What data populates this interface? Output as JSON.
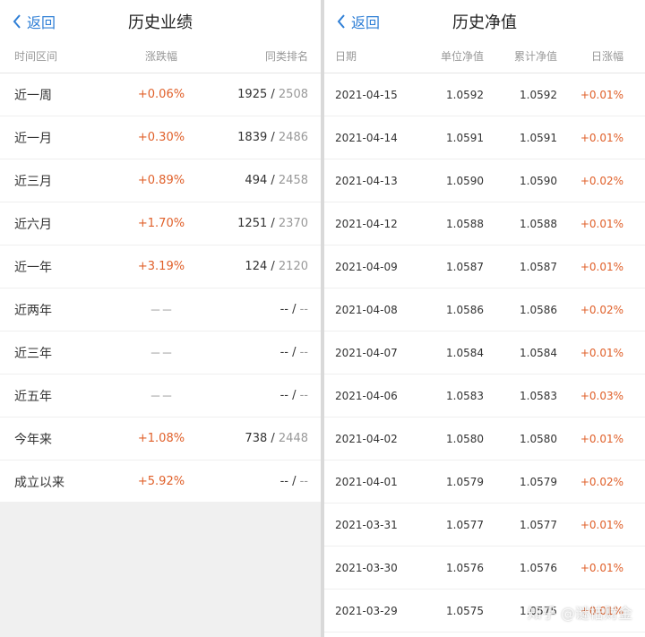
{
  "left": {
    "back_label": "返回",
    "title": "历史业绩",
    "columns": [
      "时间区间",
      "涨跌幅",
      "同类排名"
    ],
    "rows": [
      {
        "period": "近一周",
        "change": "+0.06%",
        "rank": "1925",
        "total": "2508"
      },
      {
        "period": "近一月",
        "change": "+0.30%",
        "rank": "1839",
        "total": "2486"
      },
      {
        "period": "近三月",
        "change": "+0.89%",
        "rank": "494",
        "total": "2458"
      },
      {
        "period": "近六月",
        "change": "+1.70%",
        "rank": "1251",
        "total": "2370"
      },
      {
        "period": "近一年",
        "change": "+3.19%",
        "rank": "124",
        "total": "2120"
      },
      {
        "period": "近两年",
        "change": "－－",
        "rank": "--",
        "total": "--"
      },
      {
        "period": "近三年",
        "change": "－－",
        "rank": "--",
        "total": "--"
      },
      {
        "period": "近五年",
        "change": "－－",
        "rank": "--",
        "total": "--"
      },
      {
        "period": "今年来",
        "change": "+1.08%",
        "rank": "738",
        "total": "2448"
      },
      {
        "period": "成立以来",
        "change": "+5.92%",
        "rank": "--",
        "total": "--"
      }
    ]
  },
  "right": {
    "back_label": "返回",
    "title": "历史净值",
    "columns": [
      "日期",
      "单位净值",
      "累计净值",
      "日涨幅"
    ],
    "rows": [
      {
        "date": "2021-04-15",
        "unit": "1.0592",
        "acc": "1.0592",
        "daily": "+0.01%"
      },
      {
        "date": "2021-04-14",
        "unit": "1.0591",
        "acc": "1.0591",
        "daily": "+0.01%"
      },
      {
        "date": "2021-04-13",
        "unit": "1.0590",
        "acc": "1.0590",
        "daily": "+0.02%"
      },
      {
        "date": "2021-04-12",
        "unit": "1.0588",
        "acc": "1.0588",
        "daily": "+0.01%"
      },
      {
        "date": "2021-04-09",
        "unit": "1.0587",
        "acc": "1.0587",
        "daily": "+0.01%"
      },
      {
        "date": "2021-04-08",
        "unit": "1.0586",
        "acc": "1.0586",
        "daily": "+0.02%"
      },
      {
        "date": "2021-04-07",
        "unit": "1.0584",
        "acc": "1.0584",
        "daily": "+0.01%"
      },
      {
        "date": "2021-04-06",
        "unit": "1.0583",
        "acc": "1.0583",
        "daily": "+0.03%"
      },
      {
        "date": "2021-04-02",
        "unit": "1.0580",
        "acc": "1.0580",
        "daily": "+0.01%"
      },
      {
        "date": "2021-04-01",
        "unit": "1.0579",
        "acc": "1.0579",
        "daily": "+0.02%"
      },
      {
        "date": "2021-03-31",
        "unit": "1.0577",
        "acc": "1.0577",
        "daily": "+0.01%"
      },
      {
        "date": "2021-03-30",
        "unit": "1.0576",
        "acc": "1.0576",
        "daily": "+0.01%"
      },
      {
        "date": "2021-03-29",
        "unit": "1.0575",
        "acc": "1.0575",
        "daily": "+0.01%"
      }
    ]
  },
  "watermark": "知乎 @谜桔财金",
  "colors": {
    "accent": "#2f7fd6",
    "up": "#e0602a",
    "muted": "#999999"
  }
}
